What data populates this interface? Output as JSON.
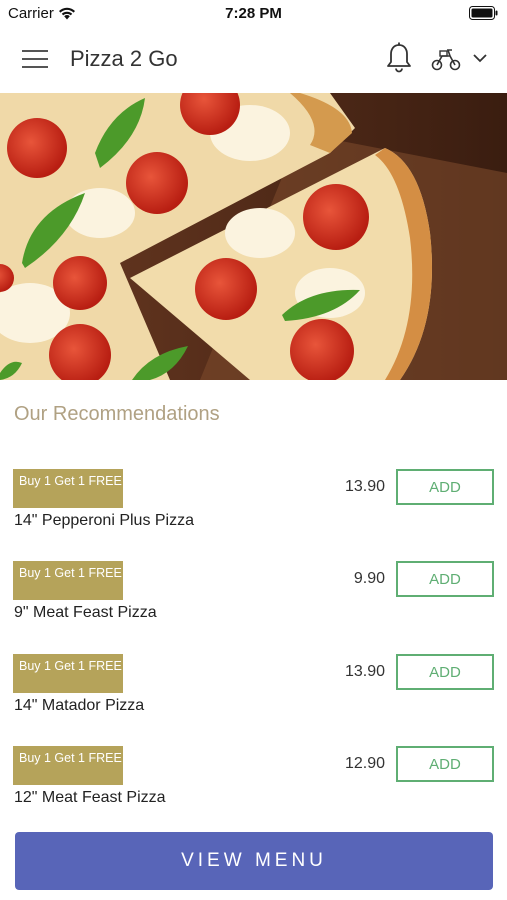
{
  "status_bar": {
    "carrier": "Carrier",
    "time": "7:28 PM"
  },
  "header": {
    "title": "Pizza 2 Go"
  },
  "section": {
    "title": "Our Recommendations"
  },
  "items": [
    {
      "badge": "Buy 1 Get 1 FREE",
      "name": "14\" Pepperoni Plus Pizza",
      "price": "13.90",
      "add_label": "ADD"
    },
    {
      "badge": "Buy 1 Get 1 FREE",
      "name": "9\" Meat Feast Pizza",
      "price": "9.90",
      "add_label": "ADD"
    },
    {
      "badge": "Buy 1 Get 1 FREE",
      "name": "14\" Matador Pizza",
      "price": "13.90",
      "add_label": "ADD"
    },
    {
      "badge": "Buy 1 Get 1 FREE",
      "name": "12\" Meat Feast Pizza",
      "price": "12.90",
      "add_label": "ADD"
    }
  ],
  "footer": {
    "view_menu_label": "VIEW MENU"
  },
  "colors": {
    "accent_button": "#5865b8",
    "add_green": "#5fae73",
    "badge_gold": "#b5a35a",
    "section_title": "#b0a183"
  },
  "icons": [
    "wifi-icon",
    "battery-icon",
    "menu-icon",
    "bell-icon",
    "scooter-icon",
    "chevron-down-icon"
  ]
}
